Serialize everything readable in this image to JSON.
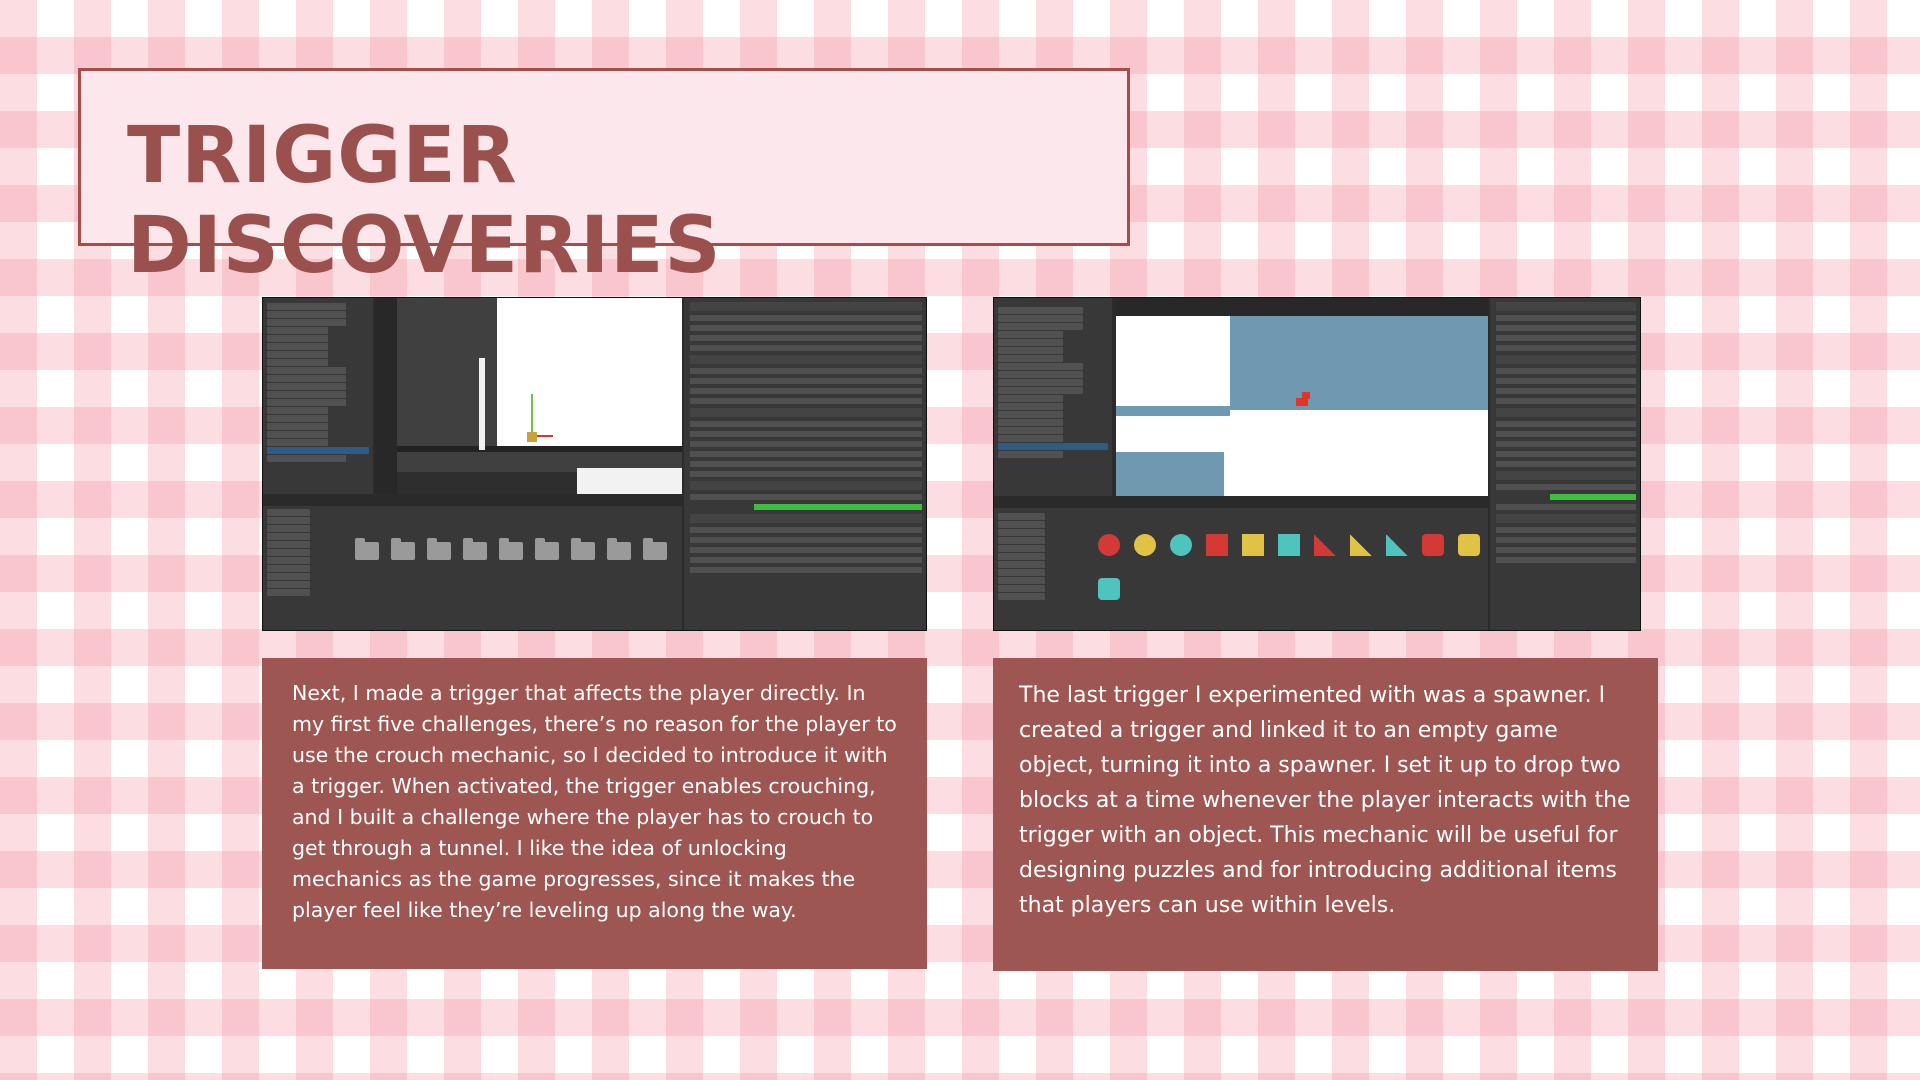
{
  "title": "TRIGGER DISCOVERIES",
  "screenshots": [
    {
      "description_icon": "unity-editor-trigger-scene-icon"
    },
    {
      "description_icon": "unity-editor-spawner-scene-icon"
    }
  ],
  "captions": {
    "left": " Next, I made a trigger that affects the player directly. In my first five challenges, there’s no reason for the player to use the crouch mechanic, so I decided to introduce it with a trigger. When activated, the trigger enables crouching, and I built a challenge where the player has to crouch to get through a tunnel. I like the idea of unlocking mechanics as the game progresses, since it makes the player feel like they’re leveling up along the way.",
    "right": "The last trigger I experimented with was a spawner. I created a trigger and linked it to an empty game object, turning it into a spawner. I set it up to drop two blocks at a time whenever the player interacts with the trigger with an object. This mechanic will be useful for designing puzzles and for introducing additional items that players can use within levels."
  },
  "colors": {
    "accent": "#9e5652",
    "title_text": "#9a504c",
    "title_bg": "#fce8ec",
    "gingham": "#f496a5"
  }
}
